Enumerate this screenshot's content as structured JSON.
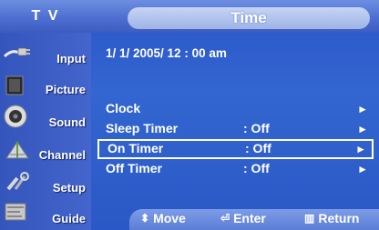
{
  "header": {
    "tv_label": "T V",
    "title": "Time"
  },
  "sidebar": {
    "items": [
      {
        "label": "Input"
      },
      {
        "label": "Picture"
      },
      {
        "label": "Sound"
      },
      {
        "label": "Channel"
      },
      {
        "label": "Setup"
      },
      {
        "label": "Guide"
      }
    ]
  },
  "main": {
    "datetime": "1/ 1/ 2005/ 12 : 00  am",
    "rows": [
      {
        "name": "Clock",
        "value": "",
        "arrow": "►"
      },
      {
        "name": "Sleep Timer",
        "value": ": Off",
        "arrow": "►"
      },
      {
        "name": "On Timer",
        "value": ": Off",
        "arrow": "►"
      },
      {
        "name": "Off Timer",
        "value": ": Off",
        "arrow": "►"
      }
    ],
    "selected_index": 2
  },
  "footer": {
    "move_icon": "⬍",
    "move": "Move",
    "enter_icon": "⏎",
    "enter": "Enter",
    "return_icon": "▥",
    "return": "Return"
  }
}
